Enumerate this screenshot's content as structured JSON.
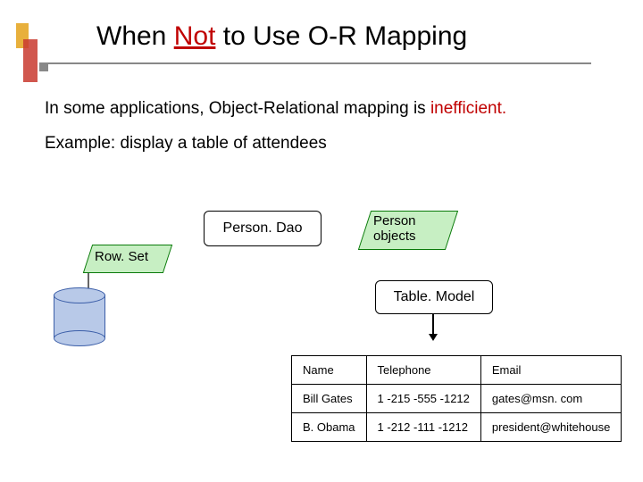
{
  "title": {
    "pre": "When ",
    "emph": "Not",
    "post": " to Use O-R Mapping"
  },
  "body": {
    "line1a": "In some applications, Object-Relational mapping is ",
    "line1b": "inefficient.",
    "line2": "Example: display a table of attendees"
  },
  "diagram": {
    "rowset": "Row. Set",
    "dao": "Person. Dao",
    "person_objects_l1": "Person",
    "person_objects_l2": "objects",
    "tablemodel": "Table. Model"
  },
  "table": {
    "headers": [
      "Name",
      "Telephone",
      "Email"
    ],
    "rows": [
      [
        "Bill Gates",
        "1 -215 -555 -1212",
        "gates@msn. com"
      ],
      [
        "B. Obama",
        "1 -212 -111 -1212",
        "president@whitehouse"
      ]
    ]
  }
}
